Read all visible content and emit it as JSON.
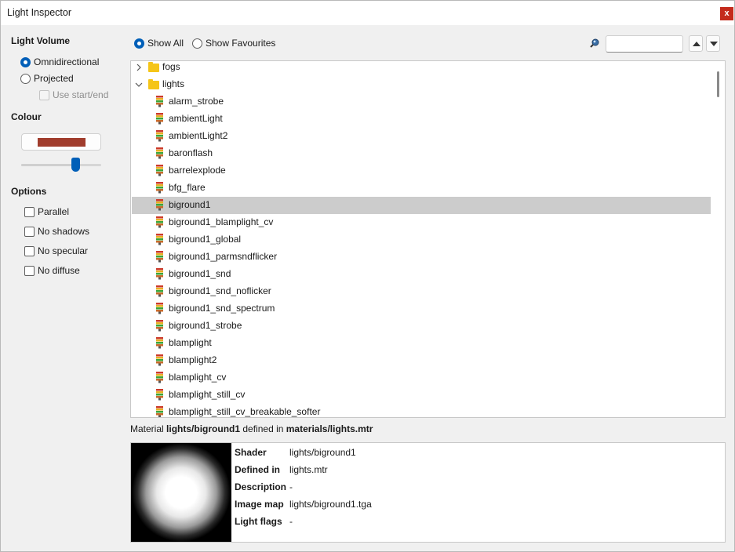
{
  "window": {
    "title": "Light Inspector",
    "close_label": "x"
  },
  "light_volume": {
    "title": "Light Volume",
    "omni_label": "Omnidirectional",
    "omni_checked": true,
    "projected_label": "Projected",
    "projected_checked": false,
    "use_start_end_label": "Use start/end",
    "use_start_end_enabled": false
  },
  "colour": {
    "title": "Colour",
    "swatch": "#a03c2c",
    "brightness_fraction": 0.68
  },
  "options": {
    "title": "Options",
    "items": [
      {
        "label": "Parallel",
        "checked": false
      },
      {
        "label": "No shadows",
        "checked": false
      },
      {
        "label": "No specular",
        "checked": false
      },
      {
        "label": "No diffuse",
        "checked": false
      }
    ]
  },
  "filter": {
    "show_all_label": "Show All",
    "show_all_checked": true,
    "show_favourites_label": "Show Favourites",
    "show_favourites_checked": false,
    "search_value": "",
    "search_icon": "search-icon"
  },
  "tree": {
    "folders": [
      {
        "label": "fogs",
        "expanded": false
      },
      {
        "label": "lights",
        "expanded": true
      }
    ],
    "items": [
      "alarm_strobe",
      "ambientLight",
      "ambientLight2",
      "baronflash",
      "barrelexplode",
      "bfg_flare",
      "biground1",
      "biground1_blamplight_cv",
      "biground1_global",
      "biground1_parmsndflicker",
      "biground1_snd",
      "biground1_snd_noflicker",
      "biground1_snd_spectrum",
      "biground1_strobe",
      "blamplight",
      "blamplight2",
      "blamplight_cv",
      "blamplight_still_cv",
      "blamplight_still_cv_breakable_softer"
    ],
    "selected": "biground1"
  },
  "material_line": {
    "prefix": "Material",
    "name": "lights/biground1",
    "middle": "defined in",
    "file": "materials/lights.mtr"
  },
  "info": {
    "shader_key": "Shader",
    "shader_val": "lights/biground1",
    "defined_key": "Defined in",
    "defined_val": "lights.mtr",
    "desc_key": "Description",
    "desc_val": "-",
    "image_key": "Image map",
    "image_val": "lights/biground1.tga",
    "flags_key": "Light flags",
    "flags_val": "-"
  },
  "colors": {
    "accent": "#005fb8",
    "close": "#c42b1c",
    "folder": "#f5c518",
    "selection": "#cccccc"
  }
}
